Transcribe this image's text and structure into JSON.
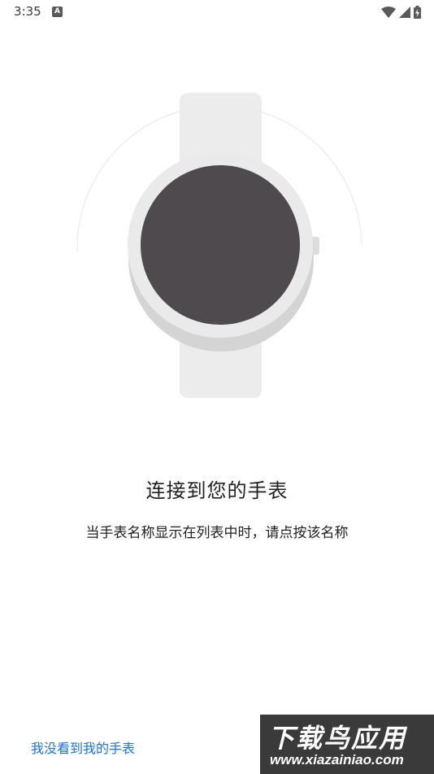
{
  "status_bar": {
    "time": "3:35",
    "notification_icon": "A",
    "icons": [
      "wifi-icon",
      "signal-icon",
      "battery-charging-icon"
    ]
  },
  "illustration": {
    "name": "smartwatch-illustration",
    "band_color": "#ececec",
    "bezel_color": "#eaeaea",
    "screen_color": "#4f4a4d"
  },
  "main": {
    "title": "连接到您的手表",
    "subtitle": "当手表名称显示在列表中时，请点按该名称"
  },
  "footer": {
    "no_watch_link": "我没看到我的手表"
  },
  "watermark": {
    "top": "下载鸟应用",
    "bottom": "www.xiazainiao.com"
  },
  "colors": {
    "link": "#1a73e8",
    "text": "#202124"
  }
}
